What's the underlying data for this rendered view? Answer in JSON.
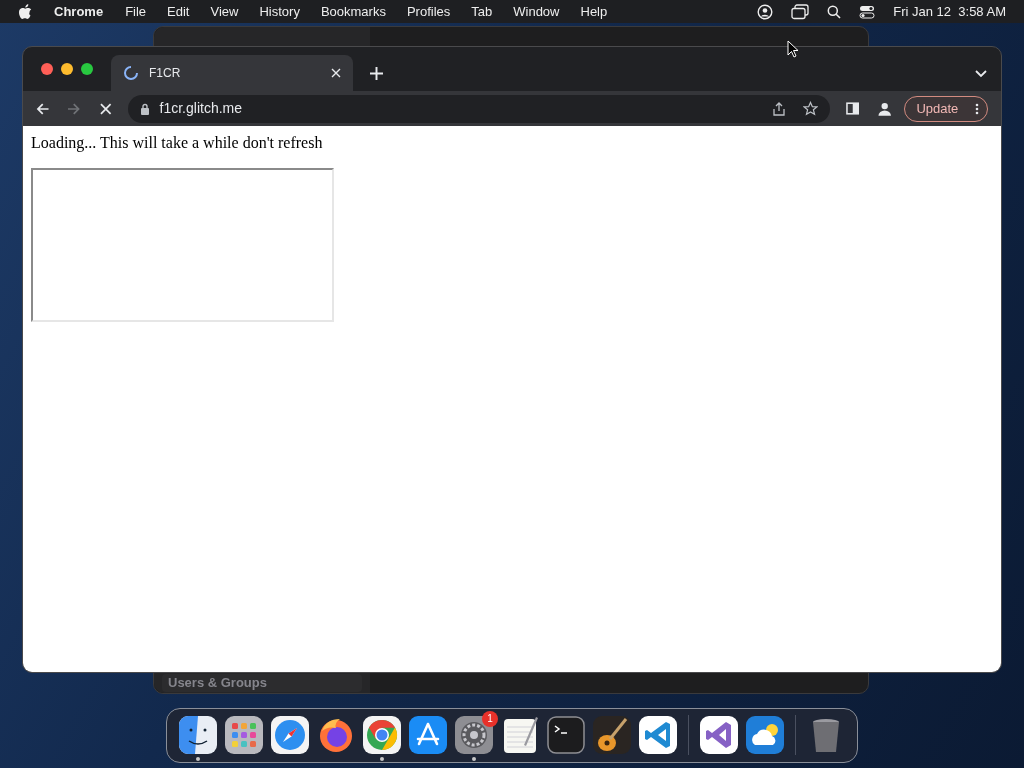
{
  "menu_bar": {
    "app_name": "Chrome",
    "menus": [
      "File",
      "Edit",
      "View",
      "History",
      "Bookmarks",
      "Profiles",
      "Tab",
      "Window",
      "Help"
    ],
    "clock": "Fri Jan 12  3:58 AM"
  },
  "background_window": {
    "sidebar_item": "Users & Groups"
  },
  "browser": {
    "tabs": [
      {
        "title": "F1CR",
        "selected": true,
        "loading": true
      }
    ],
    "nav": {
      "back_disabled": false,
      "forward_disabled": true,
      "loading": true
    },
    "address": "f1cr.glitch.me",
    "update_button": "Update",
    "page": {
      "message": "Loading... This will take a while don't refresh"
    }
  },
  "dock": {
    "groups": [
      [
        {
          "running": true
        },
        {
          "running": false
        },
        {
          "running": false
        },
        {
          "running": false
        },
        {
          "running": true
        },
        {
          "running": false
        },
        {
          "running": true,
          "badge": "1"
        },
        {
          "running": false
        },
        {
          "running": false
        },
        {
          "running": false
        },
        {
          "running": false
        }
      ],
      [
        {
          "running": false
        },
        {
          "running": false
        }
      ],
      [
        {
          "running": false
        }
      ]
    ]
  }
}
